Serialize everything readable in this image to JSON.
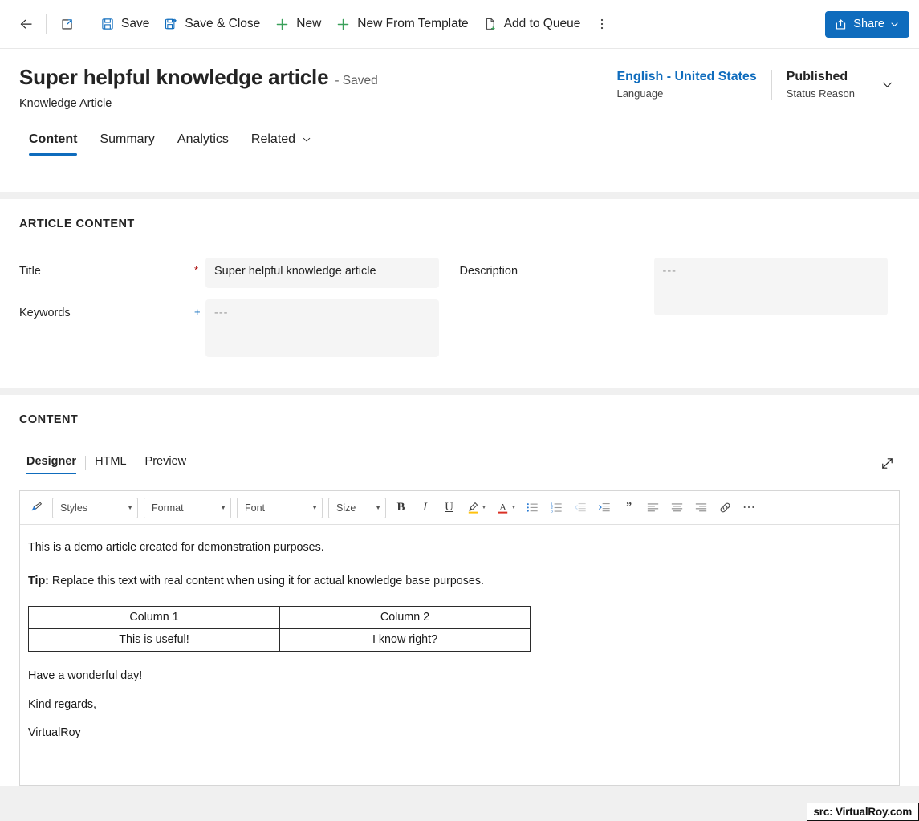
{
  "commandbar": {
    "back_label": "Back",
    "popout_label": "Open in new window",
    "save_label": "Save",
    "save_close_label": "Save & Close",
    "new_label": "New",
    "new_from_template_label": "New From Template",
    "add_to_queue_label": "Add to Queue",
    "more_label": "More commands",
    "share_label": "Share",
    "accent_color": "#0f6cbd"
  },
  "header": {
    "title": "Super helpful knowledge article",
    "saved_state": "- Saved",
    "subtitle": "Knowledge Article",
    "language_value": "English - United States",
    "language_label": "Language",
    "status_value": "Published",
    "status_label": "Status Reason",
    "link_color": "#0f6cbd"
  },
  "tabs": [
    {
      "label": "Content",
      "active": true
    },
    {
      "label": "Summary",
      "active": false
    },
    {
      "label": "Analytics",
      "active": false
    },
    {
      "label": "Related",
      "active": false,
      "has_chevron": true
    }
  ],
  "article_content": {
    "section_title": "ARTICLE CONTENT",
    "fields": [
      {
        "label": "Title",
        "marker": "*",
        "marker_type": "required",
        "value": "Super helpful knowledge article",
        "placeholder": "",
        "tall": false
      },
      {
        "label": "Keywords",
        "marker": "+",
        "marker_type": "optional",
        "value": "---",
        "placeholder": "---",
        "tall": true
      },
      {
        "label": "Description",
        "marker": "",
        "marker_type": "none",
        "value": "---",
        "placeholder": "---",
        "tall": true
      }
    ]
  },
  "content_section": {
    "section_title": "CONTENT",
    "editor_tabs": [
      {
        "label": "Designer",
        "active": true
      },
      {
        "label": "HTML",
        "active": false
      },
      {
        "label": "Preview",
        "active": false
      }
    ],
    "expand_label": "Expand editor",
    "toolbar": {
      "format_painter": "format-painter",
      "combos": [
        {
          "name": "styles",
          "label": "Styles"
        },
        {
          "name": "format",
          "label": "Format"
        },
        {
          "name": "font",
          "label": "Font"
        },
        {
          "name": "size",
          "label": "Size"
        }
      ],
      "bold": "B",
      "italic": "I",
      "underline": "U",
      "highlight_label": "Text highlight color",
      "fontcolor_label": "Font color",
      "fontcolor_letter": "A",
      "bulleted_list": "Bulleted list",
      "numbered_list": "Numbered list",
      "outdent": "Decrease indent",
      "indent": "Increase indent",
      "blockquote": "Block quote",
      "align_left": "Align left",
      "align_center": "Align center",
      "align_right": "Align right",
      "link": "Insert link",
      "more": "⋯",
      "highlight_color": "#ffc20e",
      "fontcolor_color": "#d93025"
    },
    "body": {
      "paragraph_1": "This is a demo article created for demonstration purposes.",
      "tip_label": "Tip:",
      "tip_text": " Replace this text with real content when using it for actual knowledge base purposes.",
      "table": {
        "headers": [
          "Column 1",
          "Column 2"
        ],
        "rows": [
          [
            "This is useful!",
            "I know right?"
          ]
        ]
      },
      "closing_1": "Have a wonderful day!",
      "closing_2": "Kind regards,",
      "signature": "VirtualRoy"
    }
  },
  "watermark": {
    "text": "src: VirtualRoy.com"
  }
}
